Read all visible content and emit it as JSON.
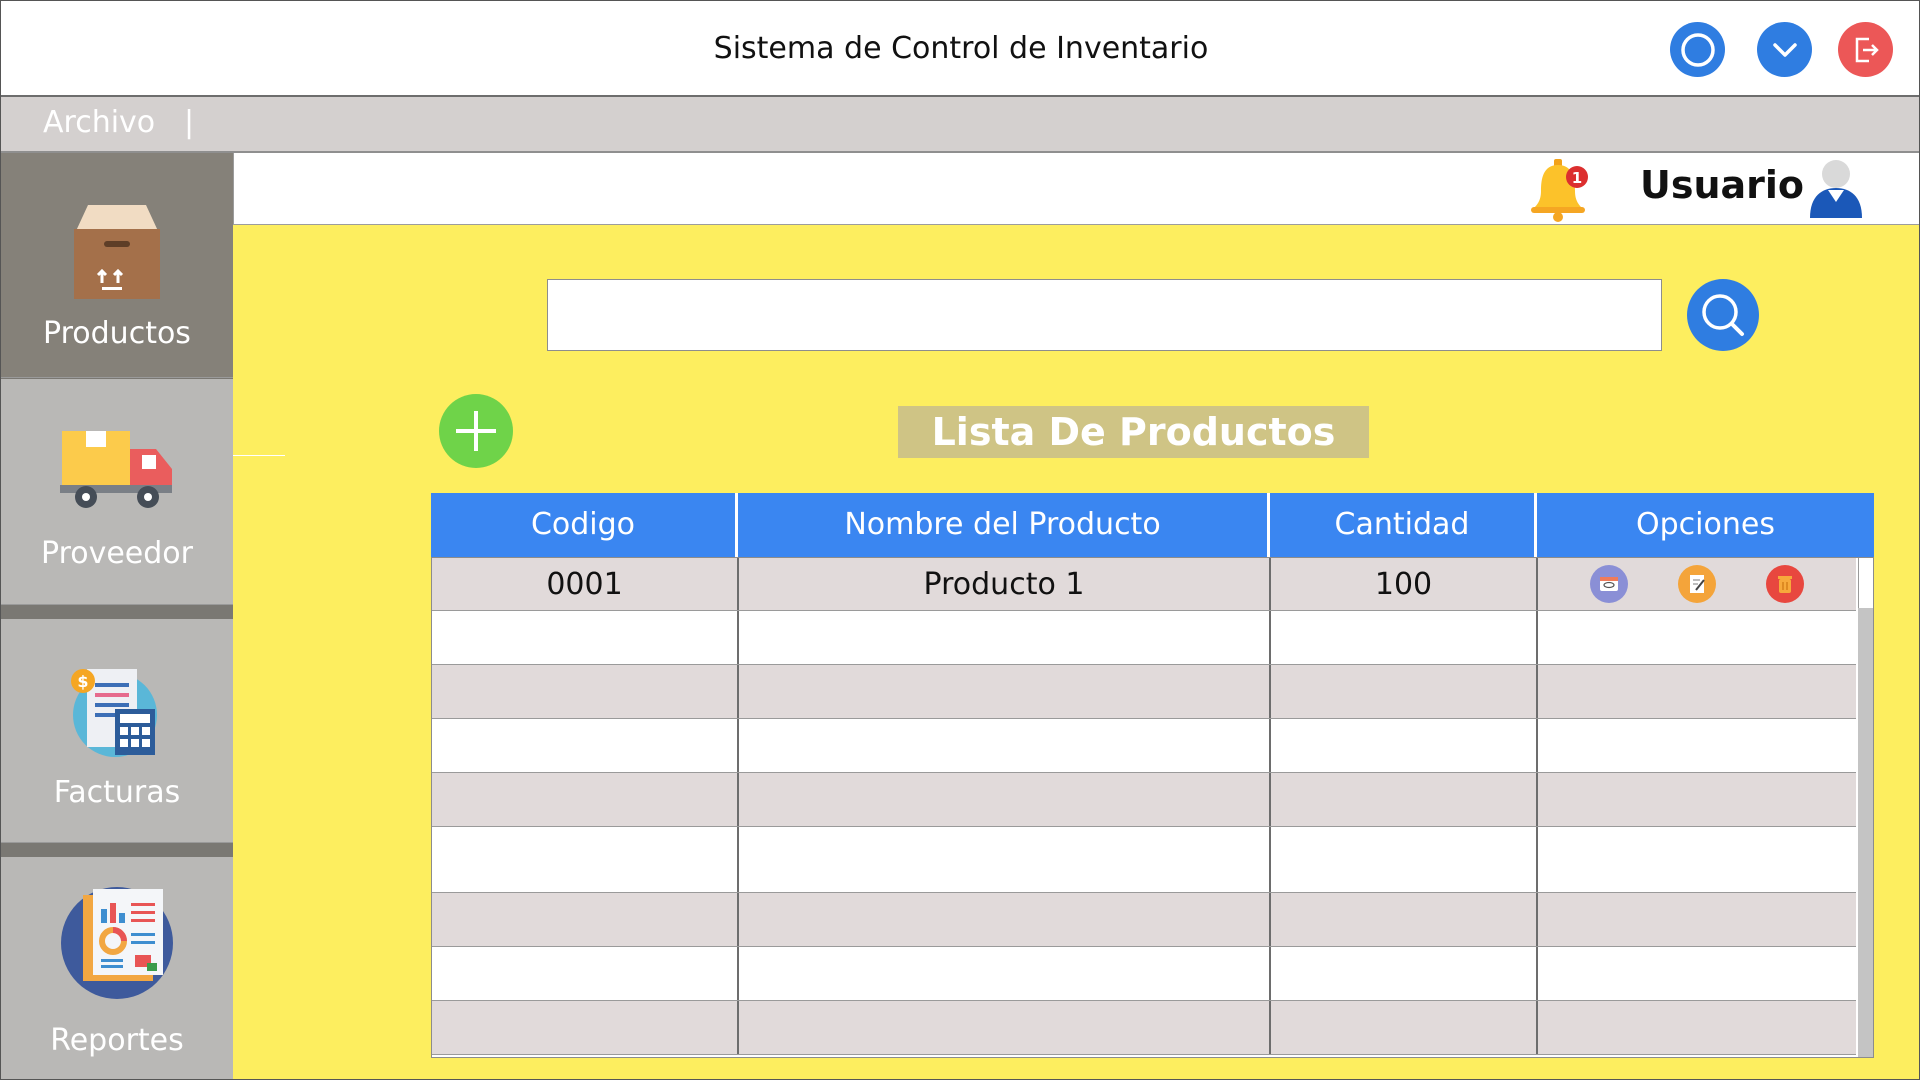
{
  "window": {
    "title": "Sistema de Control de Inventario",
    "controls": [
      "circle-icon",
      "chevron-down-icon",
      "logout-icon"
    ]
  },
  "menu": {
    "items": [
      "Archivo"
    ],
    "separator": "|"
  },
  "sidebar": {
    "items": [
      {
        "label": "Productos",
        "icon": "box-icon",
        "active": true
      },
      {
        "label": "Proveedor",
        "icon": "truck-icon",
        "active": false
      },
      {
        "label": "Facturas",
        "icon": "invoice-icon",
        "active": false
      },
      {
        "label": "Reportes",
        "icon": "report-icon",
        "active": false
      }
    ]
  },
  "header": {
    "notifications": "1",
    "user_label": "Usuario"
  },
  "search": {
    "placeholder": "",
    "value": ""
  },
  "products": {
    "title": "Lista De Productos",
    "columns": [
      "Codigo",
      "Nombre del Producto",
      "Cantidad",
      "Opciones"
    ],
    "rows": [
      {
        "codigo": "0001",
        "nombre": "Producto 1",
        "cantidad": "100",
        "options": [
          "view-icon",
          "edit-icon",
          "delete-icon"
        ]
      }
    ],
    "empty_rows": 8
  },
  "colors": {
    "accent": "#3a86f1",
    "background": "#fdee5f",
    "add": "#6fd349",
    "close": "#ec5757",
    "title_badge": "#cfc485"
  }
}
